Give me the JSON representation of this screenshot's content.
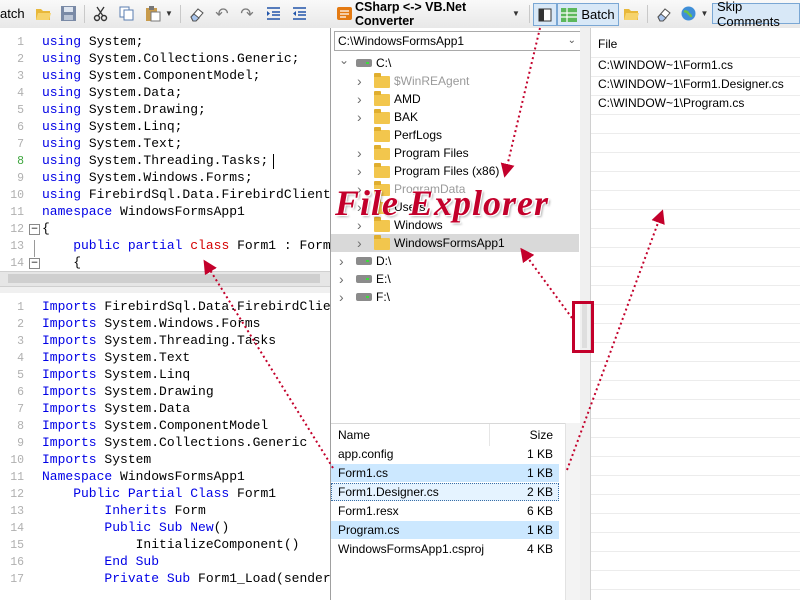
{
  "toolbar": {
    "batch_left_label": "atch",
    "converter_title": "CSharp <-> VB.Net Converter",
    "batch_label": "Batch",
    "skip_comments_label": "Skip Comments"
  },
  "csharp_editor": {
    "lines": [
      {
        "n": "1",
        "kw": "using",
        "rest": " System;"
      },
      {
        "n": "2",
        "kw": "using",
        "rest": " System.Collections.Generic;"
      },
      {
        "n": "3",
        "kw": "using",
        "rest": " System.ComponentModel;"
      },
      {
        "n": "4",
        "kw": "using",
        "rest": " System.Data;"
      },
      {
        "n": "5",
        "kw": "using",
        "rest": " System.Drawing;"
      },
      {
        "n": "6",
        "kw": "using",
        "rest": " System.Linq;"
      },
      {
        "n": "7",
        "kw": "using",
        "rest": " System.Text;"
      },
      {
        "n": "8",
        "kw": "using",
        "rest": " System.Threading.Tasks;"
      },
      {
        "n": "9",
        "kw": "using",
        "rest": " System.Windows.Forms;"
      },
      {
        "n": "10",
        "kw": "using",
        "rest": " FirebirdSql.Data.FirebirdClient;"
      },
      {
        "n": "11",
        "kw": "namespace",
        "rest": " WindowsFormsApp1"
      },
      {
        "n": "12",
        "kw": "",
        "rest": "{"
      },
      {
        "n": "13",
        "kw": "    public partial",
        "rest": ""
      },
      {
        "n": "14",
        "kw": "",
        "rest": "    {"
      }
    ],
    "line13_class_kw": "class",
    "line13_rest": " Form1 : Form"
  },
  "vb_editor": {
    "lines": [
      {
        "n": "1",
        "kw": "Imports",
        "rest": " FirebirdSql.Data.FirebirdClient"
      },
      {
        "n": "2",
        "kw": "Imports",
        "rest": " System.Windows.Forms"
      },
      {
        "n": "3",
        "kw": "Imports",
        "rest": " System.Threading.Tasks"
      },
      {
        "n": "4",
        "kw": "Imports",
        "rest": " System.Text"
      },
      {
        "n": "5",
        "kw": "Imports",
        "rest": " System.Linq"
      },
      {
        "n": "6",
        "kw": "Imports",
        "rest": " System.Drawing"
      },
      {
        "n": "7",
        "kw": "Imports",
        "rest": " System.Data"
      },
      {
        "n": "8",
        "kw": "Imports",
        "rest": " System.ComponentModel"
      },
      {
        "n": "9",
        "kw": "Imports",
        "rest": " System.Collections.Generic"
      },
      {
        "n": "10",
        "kw": "Imports",
        "rest": " System"
      },
      {
        "n": "11",
        "kw": "Namespace",
        "rest": " WindowsFormsApp1"
      },
      {
        "n": "12",
        "kw": "    Public Partial Class",
        "rest": " Form1"
      },
      {
        "n": "13",
        "kw": "        Inherits",
        "rest": " Form"
      },
      {
        "n": "14",
        "kw": "        Public Sub New",
        "rest": "()"
      },
      {
        "n": "15",
        "kw": "",
        "rest": "            InitializeComponent()"
      },
      {
        "n": "16",
        "kw": "        End Sub",
        "rest": ""
      },
      {
        "n": "17",
        "kw": "        Private Sub",
        "rest": " Form1_Load(sender"
      }
    ]
  },
  "explorer": {
    "path": "C:\\WindowsFormsApp1",
    "tree": [
      {
        "label": "C:\\",
        "kind": "drive",
        "indent": 0,
        "expanded": true
      },
      {
        "label": "$WinREAgent",
        "kind": "folder",
        "indent": 1,
        "dim": true
      },
      {
        "label": "AMD",
        "kind": "folder",
        "indent": 1
      },
      {
        "label": "BAK",
        "kind": "folder",
        "indent": 1
      },
      {
        "label": "PerfLogs",
        "kind": "folder",
        "indent": 1,
        "nochev": true
      },
      {
        "label": "Program Files",
        "kind": "folder",
        "indent": 1
      },
      {
        "label": "Program Files (x86)",
        "kind": "folder",
        "indent": 1
      },
      {
        "label": "ProgramData",
        "kind": "folder",
        "indent": 1,
        "dim": true
      },
      {
        "label": "Users",
        "kind": "folder",
        "indent": 1
      },
      {
        "label": "Windows",
        "kind": "folder",
        "indent": 1
      },
      {
        "label": "WindowsFormsApp1",
        "kind": "folder",
        "indent": 1,
        "selected": true
      },
      {
        "label": "D:\\",
        "kind": "drive",
        "indent": 0
      },
      {
        "label": "E:\\",
        "kind": "drive",
        "indent": 0
      },
      {
        "label": "F:\\",
        "kind": "drive",
        "indent": 0
      }
    ],
    "files_header": {
      "name": "Name",
      "size": "Size"
    },
    "files": [
      {
        "name": "app.config",
        "size": "1 KB"
      },
      {
        "name": "Form1.cs",
        "size": "1 KB",
        "highlight": true
      },
      {
        "name": "Form1.Designer.cs",
        "size": "2 KB",
        "focused": true
      },
      {
        "name": "Form1.resx",
        "size": "6 KB"
      },
      {
        "name": "Program.cs",
        "size": "1 KB",
        "highlight": true
      },
      {
        "name": "WindowsFormsApp1.csproj",
        "size": "4 KB"
      }
    ]
  },
  "batch_files": {
    "header": "File",
    "items": [
      "C:\\WINDOW~1\\Form1.cs",
      "C:\\WINDOW~1\\Form1.Designer.cs",
      "C:\\WINDOW~1\\Program.cs"
    ]
  },
  "overlay": {
    "title": "File Explorer"
  },
  "colors": {
    "accent_red": "#c3002b",
    "keyword_blue": "#0000e6",
    "selection": "#cce8ff"
  }
}
